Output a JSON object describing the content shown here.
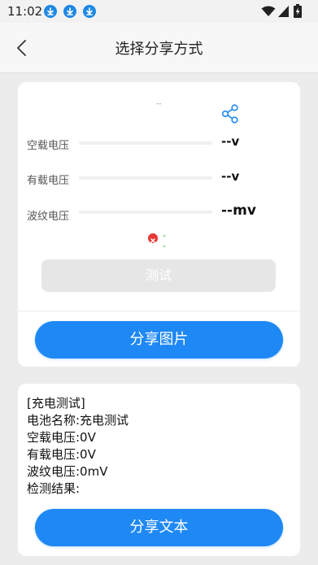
{
  "status_bar": {
    "time": "11:02",
    "notification_icons": [
      "download-icon",
      "download-icon",
      "download-icon"
    ],
    "right_icons": [
      "wifi-icon",
      "signal-icon",
      "battery-charging-icon"
    ]
  },
  "header": {
    "title": "选择分享方式",
    "back_icon": "chevron-left-icon"
  },
  "card_image": {
    "top_placeholder": "--",
    "share_icon": "share-icon",
    "rows": [
      {
        "label": "空载电压",
        "value": "--v"
      },
      {
        "label": "有载电压",
        "value": "--v"
      },
      {
        "label": "波纹电压",
        "value": "--mv"
      }
    ],
    "result": {
      "icon": "error-icon",
      "text": "--"
    },
    "test_button": "测试",
    "share_image_button": "分享图片"
  },
  "card_text": {
    "lines": [
      "[充电测试]",
      "电池名称:充电测试",
      "空载电压:0V",
      "有载电压:0V",
      "波纹电压:0mV",
      "检测结果:"
    ],
    "share_text_button": "分享文本"
  },
  "colors": {
    "primary": "#1e88f5",
    "error": "#e53935",
    "background": "#ececec"
  }
}
